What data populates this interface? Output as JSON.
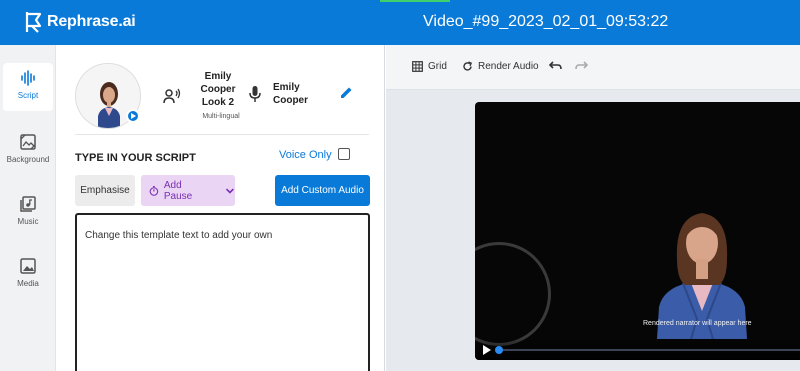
{
  "header": {
    "logo_text": "Rephrase.ai",
    "video_title": "Video_#99_2023_02_01_09:53:22",
    "brand_color": "#0a7ad9"
  },
  "sidebar": {
    "items": [
      {
        "label": "Script",
        "icon": "waveform-icon",
        "active": true
      },
      {
        "label": "Background",
        "icon": "background-icon",
        "active": false
      },
      {
        "label": "Music",
        "icon": "music-icon",
        "active": false
      },
      {
        "label": "Media",
        "icon": "image-icon",
        "active": false
      }
    ]
  },
  "avatar": {
    "name": "Emily Cooper Look 2",
    "subtitle": "Multi-lingual",
    "voice_name": "Emily Cooper"
  },
  "script": {
    "title": "TYPE IN YOUR SCRIPT",
    "voice_only_label": "Voice Only",
    "voice_only_checked": false,
    "emphasise_label": "Emphasise",
    "add_pause_label": "Add Pause",
    "add_custom_audio_label": "Add Custom Audio",
    "text": "Change this template text to add your own"
  },
  "toolbar": {
    "grid_label": "Grid",
    "render_audio_label": "Render Audio"
  },
  "preview": {
    "caption": "Rendered narrator will appear here",
    "progress": 0.0
  }
}
